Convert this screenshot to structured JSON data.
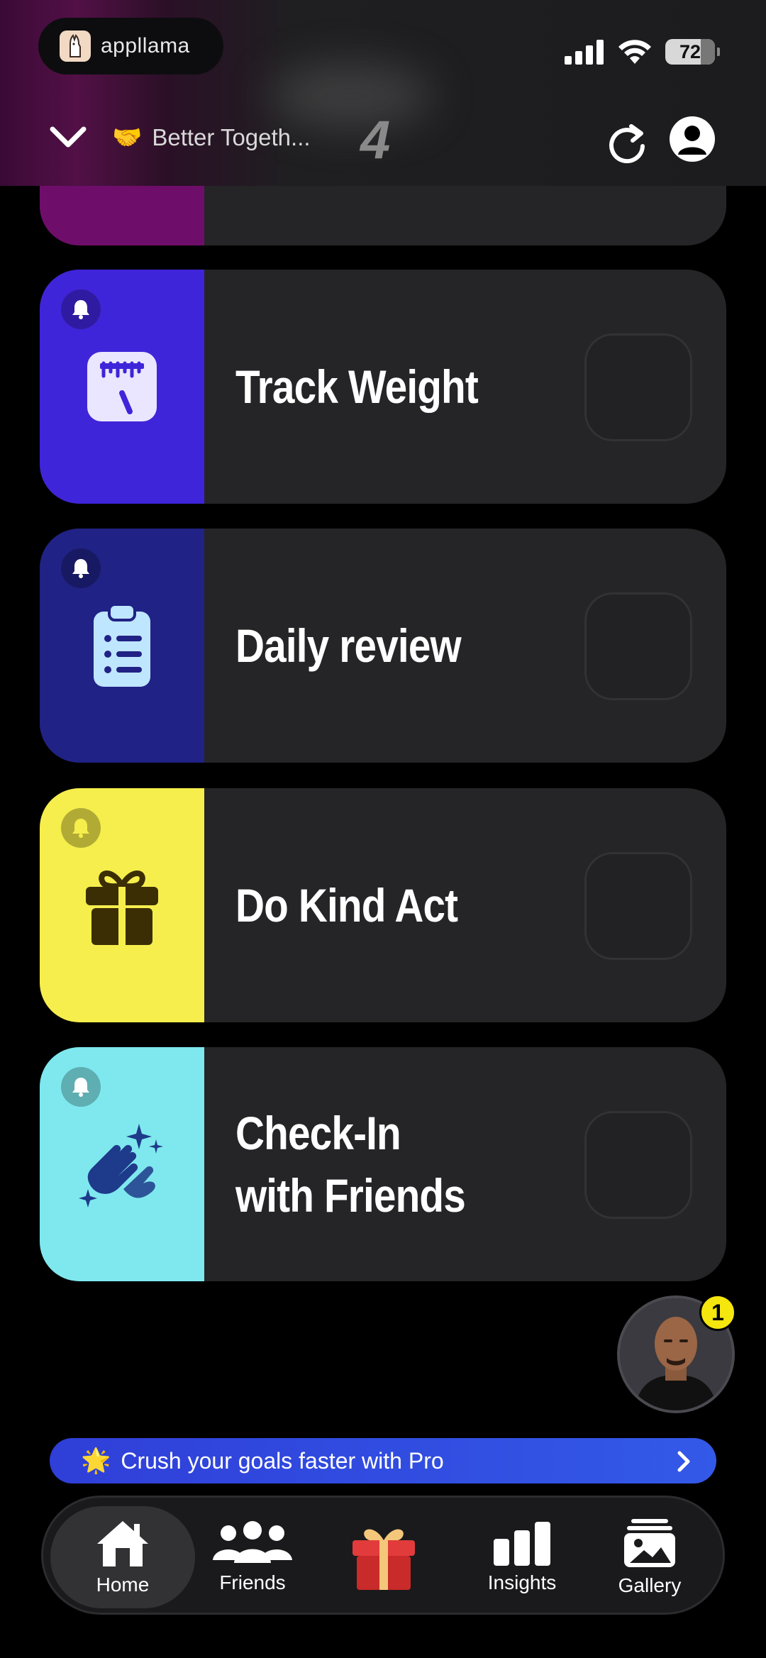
{
  "status_bar": {
    "app_name": "appllama",
    "battery": "72"
  },
  "header": {
    "emoji": "🤝",
    "title": "Better Togeth...",
    "count": "4"
  },
  "habits": [
    {
      "label": "Track Weight",
      "color": "#3f25d9",
      "icon": "scale-icon"
    },
    {
      "label": "Daily review",
      "color": "#202285",
      "icon": "clipboard-icon"
    },
    {
      "label": "Do Kind Act",
      "color": "#f6ee4c",
      "icon": "gift-icon"
    },
    {
      "label_line1": "Check-In",
      "label_line2": "with Friends",
      "color": "#7ee8ee",
      "icon": "clapping-hands-icon"
    }
  ],
  "coach": {
    "badge": "1"
  },
  "pro_banner": {
    "icon": "🌟",
    "text": "Crush your goals faster with Pro"
  },
  "tabs": [
    {
      "label": "Home",
      "icon": "home-icon",
      "active": true
    },
    {
      "label": "Friends",
      "icon": "friends-icon",
      "active": false
    },
    {
      "label": "",
      "icon": "gift-box-icon",
      "active": false
    },
    {
      "label": "Insights",
      "icon": "bar-chart-icon",
      "active": false
    },
    {
      "label": "Gallery",
      "icon": "gallery-icon",
      "active": false
    }
  ]
}
